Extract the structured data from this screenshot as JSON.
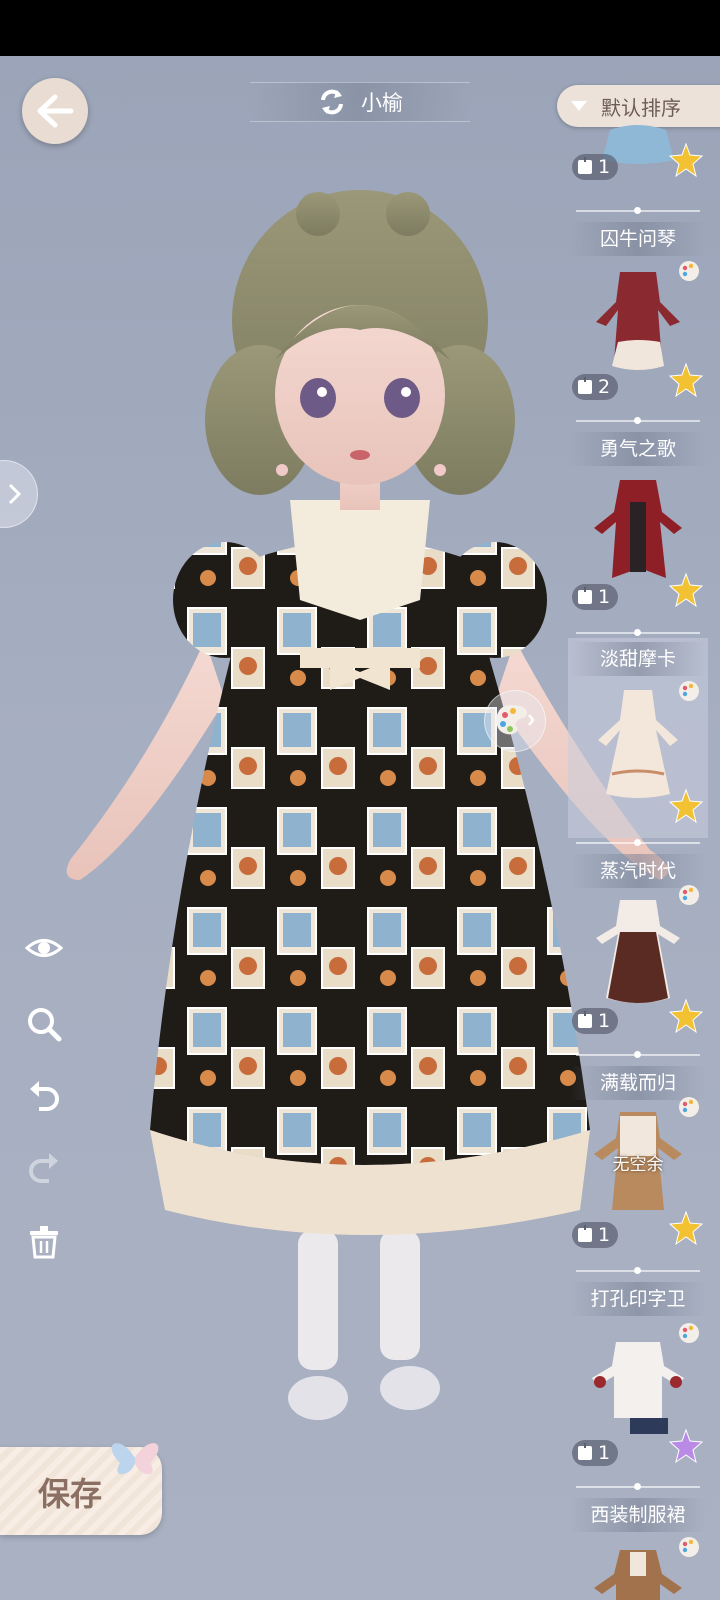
{
  "header": {
    "character_name": "小榆",
    "sort_label": "默认排序"
  },
  "save_label": "保存",
  "outfits": [
    {
      "label": "",
      "count": "1",
      "star_color": "#f2c233",
      "has_palette": false
    },
    {
      "label": "囚牛问琴",
      "count": "2",
      "star_color": "#f2c233",
      "has_palette": true
    },
    {
      "label": "勇气之歌",
      "count": "1",
      "star_color": "#f2c233",
      "has_palette": false
    },
    {
      "label": "淡甜摩卡",
      "count": "",
      "star_color": "#f2c233",
      "has_palette": true
    },
    {
      "label": "蒸汽时代",
      "count": "1",
      "star_color": "#f2c233",
      "has_palette": true
    },
    {
      "label": "满载而归",
      "count": "1",
      "star_color": "#f2c233",
      "has_palette": true,
      "overlay": "无空余"
    },
    {
      "label": "打孔印字卫",
      "count": "1",
      "star_color": "#b98be6",
      "has_palette": true
    },
    {
      "label": "西装制服裙",
      "count": "",
      "star_color": "#f2c233",
      "has_palette": true
    }
  ],
  "tools": [
    "eye-icon",
    "zoom-icon",
    "undo-icon",
    "redo-icon",
    "trash-icon"
  ],
  "colors": {
    "accent": "#ece2da",
    "text_brown": "#8a6f62",
    "bg": "#9ba4b8"
  }
}
